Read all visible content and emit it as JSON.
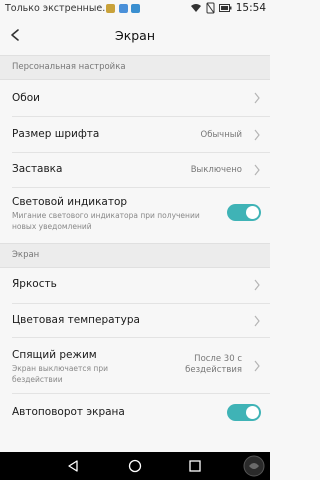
{
  "status_bar": {
    "carrier_text": "Только экстренные...",
    "time": "15:54",
    "notif_colors": [
      "#c9a23a",
      "#4a90d9",
      "#3a8fd0"
    ]
  },
  "header": {
    "title": "Экран",
    "back_icon": "back-arrow-icon"
  },
  "sections": [
    {
      "label": "Персональная настройка",
      "items": [
        {
          "title": "Обои",
          "control": "chevron"
        },
        {
          "title": "Размер шрифта",
          "value": "Обычный",
          "control": "chevron"
        },
        {
          "title": "Заставка",
          "value": "Выключено",
          "control": "chevron"
        },
        {
          "title": "Световой индикатор",
          "subtitle": "Мигание светового индикатора при получении новых уведомлений",
          "control": "toggle",
          "toggle_on": true
        }
      ]
    },
    {
      "label": "Экран",
      "items": [
        {
          "title": "Яркость",
          "control": "chevron"
        },
        {
          "title": "Цветовая температура",
          "control": "chevron"
        },
        {
          "title": "Спящий режим",
          "subtitle": "Экран выключается при бездействии",
          "value": "После 30 с бездействия",
          "control": "chevron"
        },
        {
          "title": "Автоповорот экрана",
          "control": "toggle",
          "toggle_on": true
        }
      ]
    }
  ],
  "nav_bar": {
    "buttons": [
      "back-triangle-icon",
      "home-circle-icon",
      "recents-square-icon"
    ]
  },
  "colors": {
    "accent": "#3fb3b6",
    "background": "#f7f7f7",
    "section_bg": "#ececec"
  }
}
